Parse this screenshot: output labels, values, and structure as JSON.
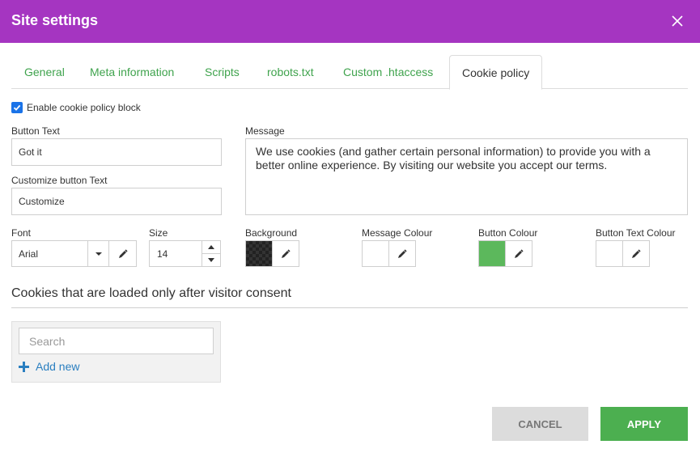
{
  "header": {
    "title": "Site settings"
  },
  "tabs": [
    {
      "label": "General"
    },
    {
      "label": "Meta information"
    },
    {
      "label": "Scripts"
    },
    {
      "label": "robots.txt"
    },
    {
      "label": "Custom .htaccess"
    },
    {
      "label": "Cookie policy",
      "active": true
    }
  ],
  "form": {
    "enable_label": "Enable cookie policy block",
    "enable_checked": true,
    "button_text_label": "Button Text",
    "button_text_value": "Got it",
    "customize_label": "Customize button Text",
    "customize_value": "Customize",
    "message_label": "Message",
    "message_value": "We use cookies (and gather certain personal information) to provide you with a better online experience. By visiting our website you accept our terms.",
    "font_label": "Font",
    "font_value": "Arial",
    "size_label": "Size",
    "size_value": "14",
    "background_label": "Background",
    "message_colour_label": "Message Colour",
    "button_colour_label": "Button Colour",
    "button_text_colour_label": "Button Text Colour"
  },
  "colors": {
    "header": "#a535c1",
    "accent_green": "#4caf50",
    "tab_link": "#3fa34d",
    "background_swatch": "#2b2b2b",
    "message_swatch": "#ffffff",
    "button_swatch": "#5cb85c",
    "button_text_swatch": "#ffffff"
  },
  "consent": {
    "title": "Cookies that are loaded only after visitor consent",
    "search_placeholder": "Search",
    "add_new_label": "Add new"
  },
  "footer": {
    "cancel_label": "CANCEL",
    "apply_label": "APPLY"
  },
  "icons": [
    "close-icon",
    "check-icon",
    "chevron-down-icon",
    "eyedropper-icon",
    "spinner-up-icon",
    "spinner-down-icon",
    "plus-icon"
  ]
}
